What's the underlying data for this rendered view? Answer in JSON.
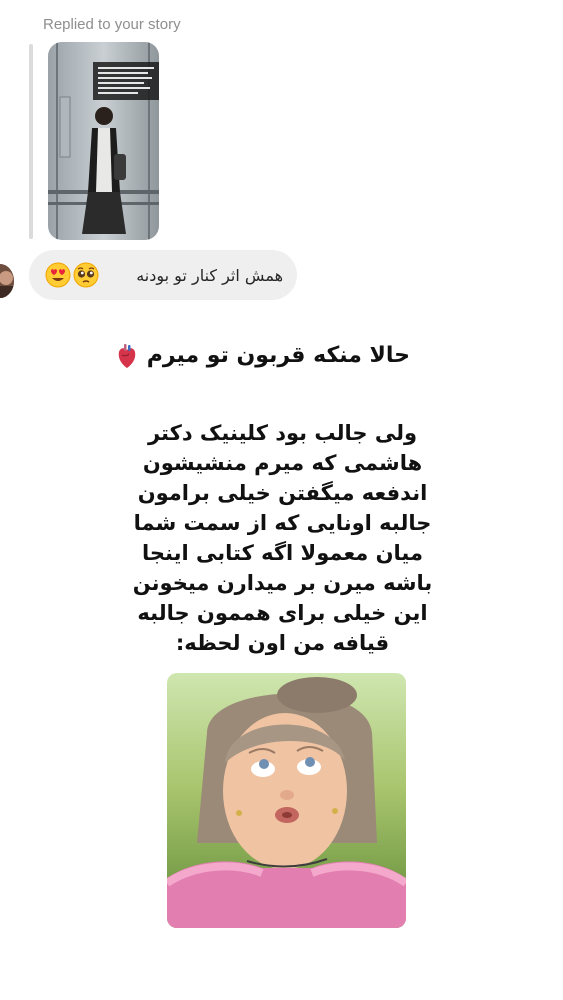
{
  "reply": {
    "label": "Replied to your story"
  },
  "message": {
    "text": "همش اثر کنار  تو بودنه",
    "emojis": [
      "smiling-face-with-heart-eyes",
      "pleading-face"
    ]
  },
  "post": {
    "headline": "حالا منکه قربون تو میرم",
    "headline_emoji": "anatomical-heart",
    "paragraph_lines": [
      "ولی جالب بود کلینیک دکتر",
      "هاشمی که میرم منشیشون",
      "اندفعه میگفتن خیلی برامون",
      "جالبه اونایی که از سمت شما",
      "میان معمولا اگه کتابی اینجا",
      "باشه میرن بر میدارن میخونن",
      "این خیلی برای هممون جالبه",
      "قیافه من اون لحظه:"
    ]
  },
  "colors": {
    "bubble_bg": "#efefef",
    "meta_text": "#8e8e8e",
    "reply_bar": "#dbdbdb",
    "body_text": "#111111"
  }
}
